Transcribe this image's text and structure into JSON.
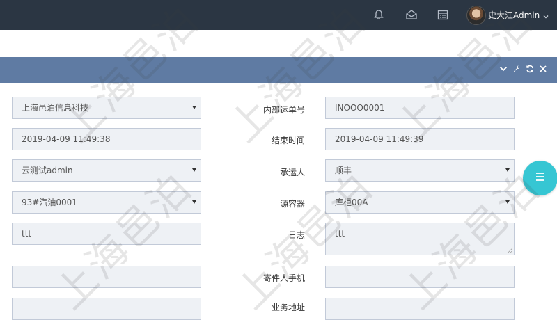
{
  "header": {
    "username": "史大江Admin"
  },
  "form": {
    "company": {
      "value": "上海邑泊信息科技"
    },
    "start_time": {
      "value": "2019-04-09 11:49:38"
    },
    "user": {
      "value": "云测试admin"
    },
    "product": {
      "value": "93#汽油0001"
    },
    "notes": {
      "value": "ttt"
    },
    "blank_left": {
      "value": ""
    },
    "internal_waybill": {
      "label": "内部运单号",
      "value": "INOOO0001"
    },
    "end_time": {
      "label": "结束时间",
      "value": "2019-04-09 11:49:39"
    },
    "carrier": {
      "label": "承运人",
      "value": "顺丰"
    },
    "source_container": {
      "label": "源容器",
      "value": "库柜00A"
    },
    "log": {
      "label": "日志",
      "value": "ttt"
    },
    "sender_phone": {
      "label": "寄件人手机",
      "value": ""
    },
    "partial_label": {
      "label": "业务地址"
    }
  },
  "watermark": {
    "text": "上海邑泊"
  },
  "icons": {
    "bell": "bell-icon",
    "mail": "mail-icon",
    "calendar": "calendar-icon",
    "user_chevron": "chevron-down-icon",
    "collapse": "chevron-down-icon",
    "settings": "wrench-icon",
    "reload": "reload-icon",
    "close": "close-icon",
    "fab": "menu-icon"
  },
  "colors": {
    "topbar": "#2b3643",
    "panel_header": "#5f7ba3",
    "field_bg": "#eef1f5",
    "fab": "#36c6d3"
  }
}
